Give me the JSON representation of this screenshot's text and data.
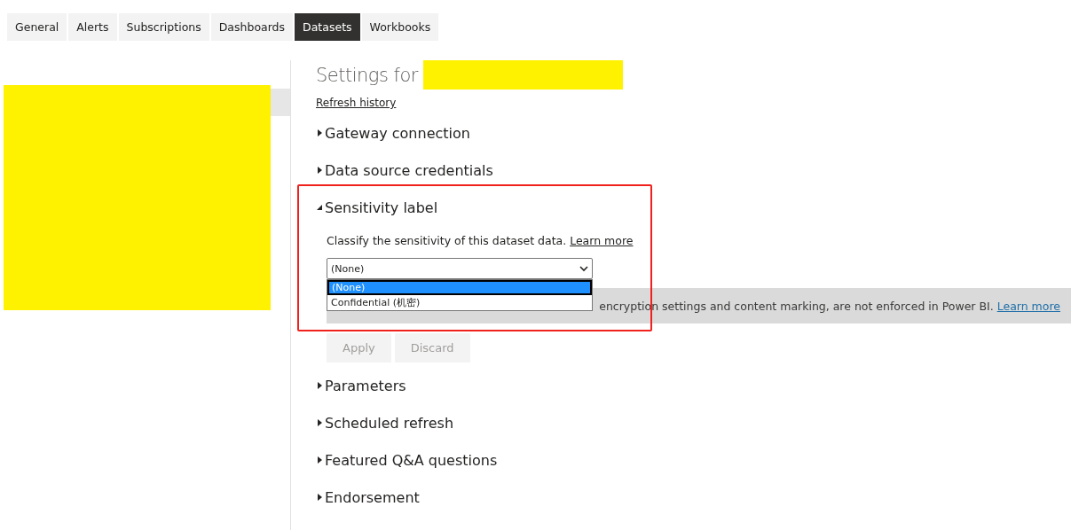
{
  "tabs": [
    {
      "label": "General",
      "selected": false
    },
    {
      "label": "Alerts",
      "selected": false
    },
    {
      "label": "Subscriptions",
      "selected": false
    },
    {
      "label": "Dashboards",
      "selected": false
    },
    {
      "label": "Datasets",
      "selected": true
    },
    {
      "label": "Workbooks",
      "selected": false
    }
  ],
  "settings": {
    "title": "Settings for",
    "refresh_link": "Refresh history"
  },
  "sections": [
    {
      "title": "Gateway connection",
      "expanded": false
    },
    {
      "title": "Data source credentials",
      "expanded": false
    },
    {
      "title": "Sensitivity label",
      "expanded": true,
      "highlighted": true,
      "description": "Classify the sensitivity of this dataset data.",
      "learn_more": "Learn more",
      "dropdown": {
        "value": "(None)",
        "expanded": true,
        "options": [
          {
            "label": "(None)",
            "selected": true
          },
          {
            "label": "Confidential (机密)",
            "selected": false
          }
        ]
      },
      "note": {
        "text": "encryption settings and content marking, are not enforced in Power BI.",
        "link": "Learn more"
      },
      "buttons": [
        {
          "label": "Apply",
          "disabled": true
        },
        {
          "label": "Discard",
          "disabled": true
        }
      ]
    },
    {
      "title": "Parameters",
      "expanded": false
    },
    {
      "title": "Scheduled refresh",
      "expanded": false
    },
    {
      "title": "Featured Q&A questions",
      "expanded": false
    },
    {
      "title": "Endorsement",
      "expanded": false
    }
  ]
}
